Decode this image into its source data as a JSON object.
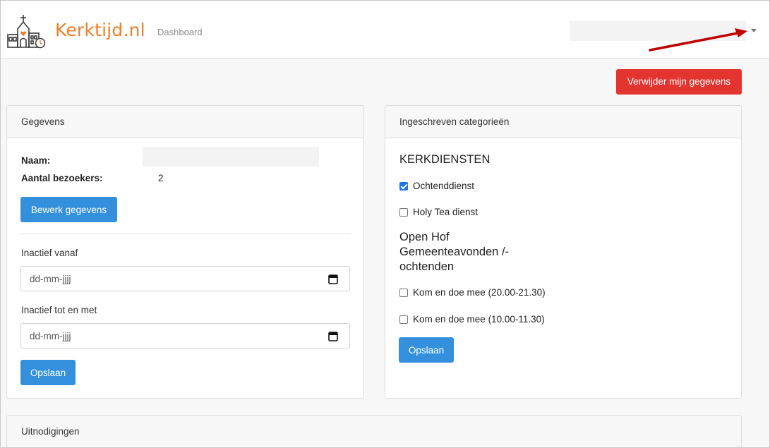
{
  "brand": {
    "name": "Kerktijd.nl"
  },
  "nav": {
    "dashboard": "Dashboard"
  },
  "colors": {
    "brand": "#ee7d2a",
    "primary": "#3490dc",
    "danger": "#e3342f",
    "annotation_arrow": "#c00000"
  },
  "actions": {
    "delete_data": "Verwijder mijn gegevens"
  },
  "gegevens": {
    "header": "Gegevens",
    "name_label": "Naam:",
    "visitors_label": "Aantal bezoekers:",
    "visitors_value": "2",
    "edit_button": "Bewerk gegevens",
    "inactive_from_label": "Inactief vanaf",
    "inactive_from_placeholder": "dd-mm-jjjj",
    "inactive_until_label": "Inactief tot en met",
    "inactive_until_placeholder": "dd-mm-jjjj",
    "save_button": "Opslaan"
  },
  "categories": {
    "header": "Ingeschreven categorieën",
    "section1_title": "KERKDIENSTEN",
    "section1_items": [
      {
        "label": "Ochtenddienst",
        "checked": true
      },
      {
        "label": "Holy Tea dienst",
        "checked": false
      }
    ],
    "section2_title_lines": [
      "Open Hof",
      "Gemeenteavonden /-",
      "ochtenden"
    ],
    "section2_items": [
      {
        "label": "Kom en doe mee (20.00-21.30)",
        "checked": false
      },
      {
        "label": "Kom en doe mee (10.00-11.30)",
        "checked": false
      }
    ],
    "save_button": "Opslaan"
  },
  "invitations": {
    "header": "Uitnodigingen"
  }
}
